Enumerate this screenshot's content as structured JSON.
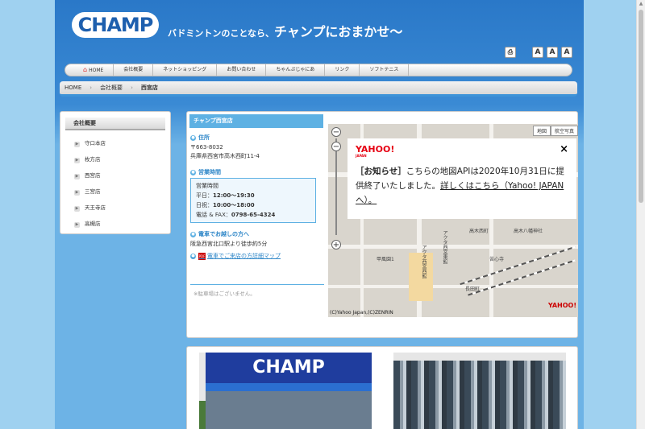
{
  "header": {
    "logo_text": "CHAMP",
    "tagline_part1": "バドミントンのことなら、",
    "tagline_part2": "チャンプにおまかせ〜",
    "print_icon": "printer-icon",
    "font_sizes": [
      "A",
      "A",
      "A"
    ]
  },
  "nav": {
    "items": [
      "HOME",
      "会社概要",
      "ネットショッピング",
      "お問い合わせ",
      "ちゃんぷじゃにあ",
      "リンク",
      "ソフトテニス"
    ]
  },
  "breadcrumb": {
    "items": [
      "HOME",
      "会社概要"
    ],
    "current": "西宮店"
  },
  "sidebar": {
    "title": "会社概要",
    "items": [
      "守口本店",
      "枚方店",
      "西宮店",
      "三宮店",
      "天王寺店",
      "高槻店"
    ]
  },
  "shop": {
    "title": "チャンプ西宮店",
    "address_heading": "住所",
    "postal": "〒663-8032",
    "address": "兵庫県西宮市高木西町11-4",
    "hours_heading": "営業時間",
    "hours_label": "営業時間",
    "weekday_label": "平日：",
    "weekday_hours": "12:00〜19:30",
    "holiday_label": "日祝：",
    "holiday_hours": "10:00〜18:00",
    "phone_label": "電話 & FAX：",
    "phone": "0798-65-4324",
    "train_heading": "電車でお越しの方へ",
    "train_text": "阪急西宮北口駅より徒歩約5分",
    "pdf_icon": "PDF",
    "pdf_link": "電車でご来店の方詳細マップ",
    "parking": "※駐車場はございません。"
  },
  "map": {
    "type_buttons": [
      "地図",
      "航空写真"
    ],
    "labels": [
      "高木西町",
      "高木八幡神社",
      "苦心寺",
      "長田町",
      "甲風園1",
      "アクタ西宮東館",
      "アクタ西宮西館"
    ],
    "copyright": "(C)Yahoo Japan,(C)ZENRIN",
    "logo": "YAHOO!",
    "notice": {
      "logo": "YAHOO!",
      "logo_sub": "JAPAN",
      "close": "×",
      "bracket_title": "［お知らせ］",
      "text": "こちらの地図APIは2020年10月31日に提供終了いたしました。",
      "link": "詳しくはこちら（Yahoo! JAPANへ）。"
    }
  },
  "photos": {
    "sign_text": "CHAMP"
  }
}
